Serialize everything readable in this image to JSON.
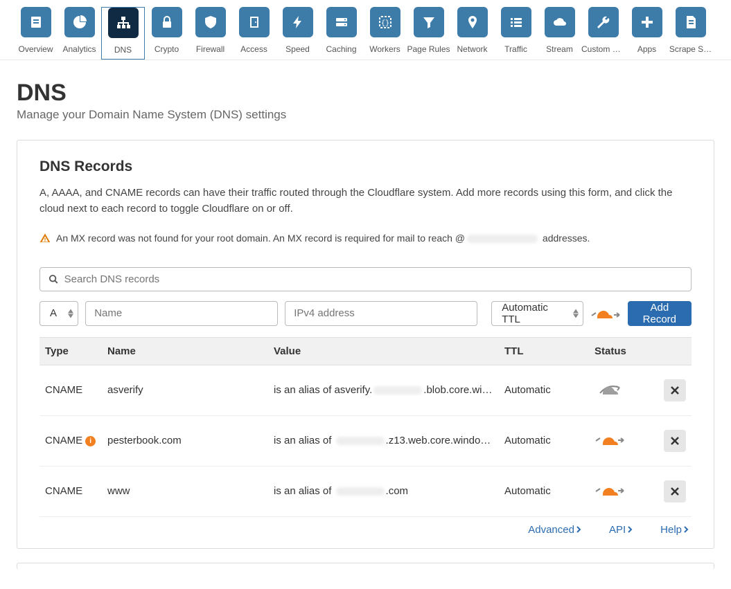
{
  "nav": [
    {
      "label": "Overview",
      "icon": "doc"
    },
    {
      "label": "Analytics",
      "icon": "pie"
    },
    {
      "label": "DNS",
      "icon": "sitemap",
      "active": true
    },
    {
      "label": "Crypto",
      "icon": "lock"
    },
    {
      "label": "Firewall",
      "icon": "shield"
    },
    {
      "label": "Access",
      "icon": "door"
    },
    {
      "label": "Speed",
      "icon": "bolt"
    },
    {
      "label": "Caching",
      "icon": "drive"
    },
    {
      "label": "Workers",
      "icon": "braces"
    },
    {
      "label": "Page Rules",
      "icon": "funnel"
    },
    {
      "label": "Network",
      "icon": "pin"
    },
    {
      "label": "Traffic",
      "icon": "list"
    },
    {
      "label": "Stream",
      "icon": "cloud"
    },
    {
      "label": "Custom P…",
      "icon": "wrench"
    },
    {
      "label": "Apps",
      "icon": "plus"
    },
    {
      "label": "Scrape S…",
      "icon": "page"
    }
  ],
  "page": {
    "title": "DNS",
    "subtitle": "Manage your Domain Name System (DNS) settings"
  },
  "records_card": {
    "title": "DNS Records",
    "description": "A, AAAA, and CNAME records can have their traffic routed through the Cloudflare system. Add more records using this form, and click the cloud next to each record to toggle Cloudflare on or off.",
    "warning_prefix": "An MX record was not found for your root domain. An MX record is required for mail to reach @",
    "warning_suffix": " addresses."
  },
  "search": {
    "placeholder": "Search DNS records"
  },
  "add_form": {
    "type_value": "A",
    "name_placeholder": "Name",
    "value_placeholder": "IPv4 address",
    "ttl_value": "Automatic TTL",
    "button": "Add Record"
  },
  "table": {
    "headers": {
      "type": "Type",
      "name": "Name",
      "value": "Value",
      "ttl": "TTL",
      "status": "Status"
    },
    "rows": [
      {
        "type": "CNAME",
        "info": false,
        "name": "asverify",
        "value_prefix": "is an alias of asverify.",
        "value_redacted": true,
        "value_suffix": ".blob.core.wi…",
        "ttl": "Automatic",
        "proxied": false
      },
      {
        "type": "CNAME",
        "info": true,
        "name": "pesterbook.com",
        "value_prefix": "is an alias of ",
        "value_redacted": true,
        "value_suffix": ".z13.web.core.windo…",
        "ttl": "Automatic",
        "proxied": true
      },
      {
        "type": "CNAME",
        "info": false,
        "name": "www",
        "value_prefix": "is an alias of ",
        "value_redacted": true,
        "value_suffix": ".com",
        "ttl": "Automatic",
        "proxied": true
      }
    ]
  },
  "footer_links": {
    "advanced": "Advanced",
    "api": "API",
    "help": "Help"
  }
}
